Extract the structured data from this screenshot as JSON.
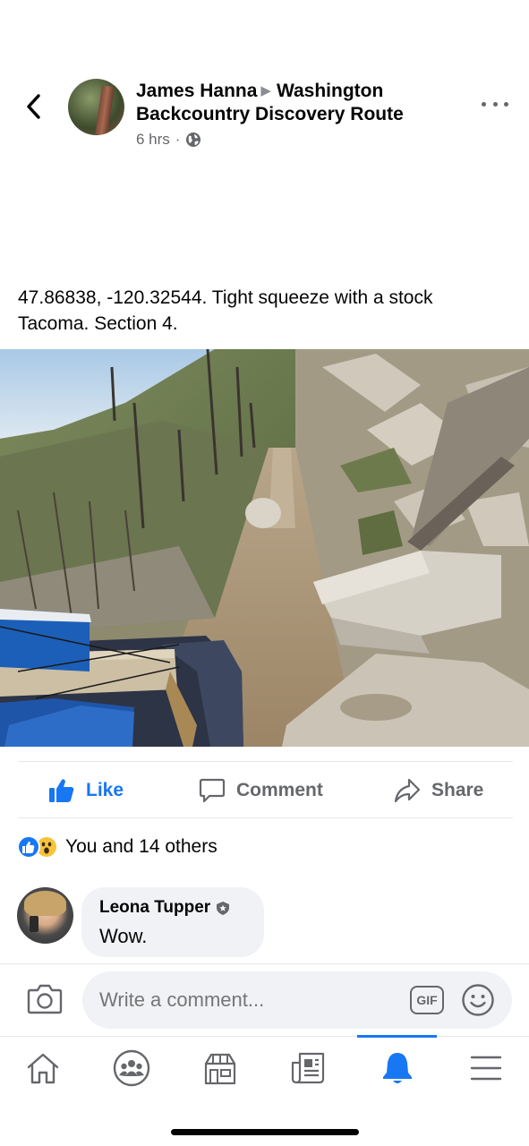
{
  "post": {
    "author": "James Hanna",
    "group": "Washington Backcountry Discovery Route",
    "time": "6 hrs",
    "text": "47.86838, -120.32544. Tight squeeze with a stock Tacoma. Section 4."
  },
  "actions": {
    "like": "Like",
    "comment": "Comment",
    "share": "Share"
  },
  "reactions": {
    "text": "You and 14 others"
  },
  "comment": {
    "author": "Leona Tupper",
    "text": "Wow."
  },
  "composer": {
    "placeholder": "Write a comment...",
    "gif": "GIF"
  },
  "tabbar": {
    "active": "notifications",
    "tabs": [
      "home",
      "groups",
      "marketplace",
      "news",
      "notifications",
      "menu"
    ]
  },
  "colors": {
    "accent": "#1877f2",
    "secondary_text": "#65676b",
    "bubble": "#f0f2f5"
  }
}
